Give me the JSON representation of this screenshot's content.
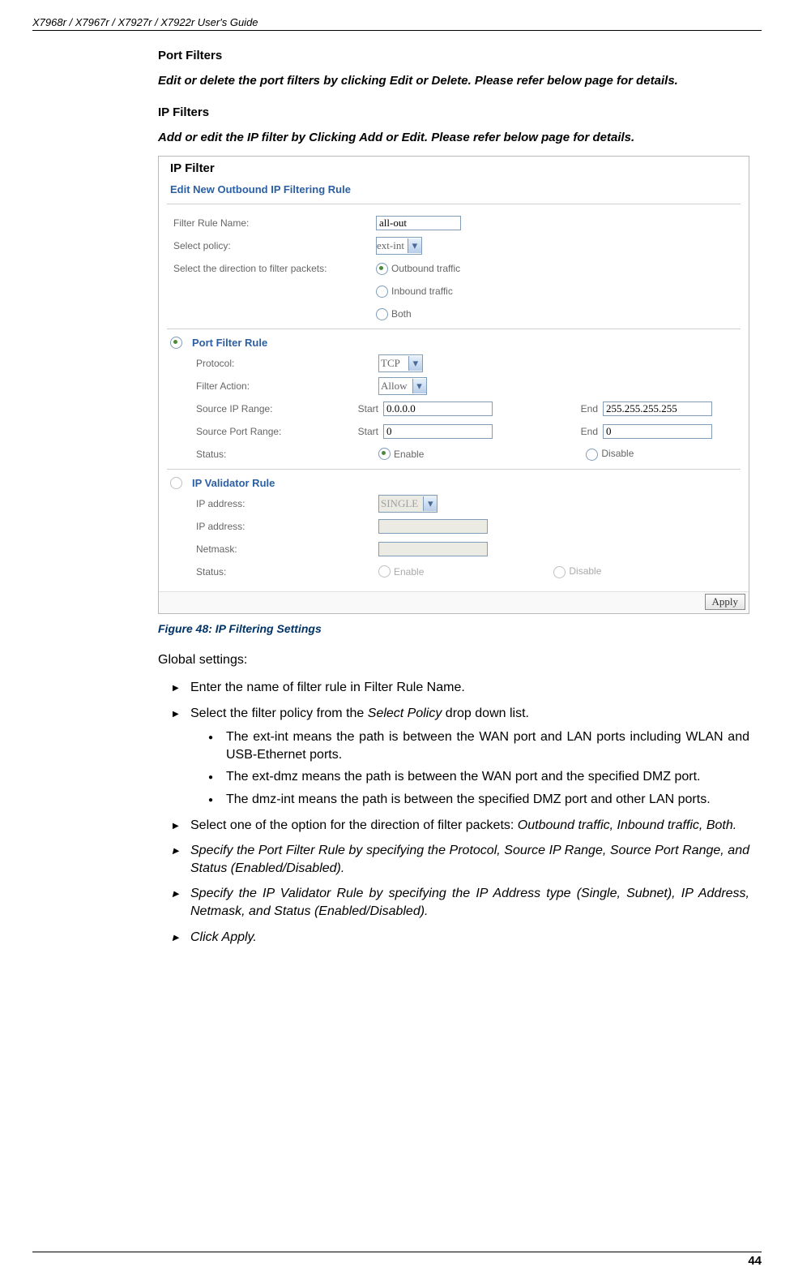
{
  "header": {
    "title": "X7968r / X7967r / X7927r / X7922r User's Guide"
  },
  "sections": {
    "port_filters_heading": "Port Filters",
    "port_filters_note": "Edit or delete the port filters by clicking Edit or Delete. Please refer below page for details.",
    "ip_filters_heading": "IP Filters",
    "ip_filters_note": "Add or edit the IP filter by Clicking Add or Edit. Please refer below page for details."
  },
  "ui": {
    "title": "IP Filter",
    "subtitle": "Edit New Outbound IP Filtering Rule",
    "rows": {
      "filter_rule_name_label": "Filter Rule Name:",
      "filter_rule_name_value": "all-out",
      "select_policy_label": "Select policy:",
      "select_policy_value": "ext-int",
      "direction_label": "Select the direction to filter packets:",
      "direction_opt1": "Outbound traffic",
      "direction_opt2": "Inbound traffic",
      "direction_opt3": "Both"
    },
    "port_rule": {
      "heading": "Port Filter Rule",
      "protocol_label": "Protocol:",
      "protocol_value": "TCP",
      "action_label": "Filter Action:",
      "action_value": "Allow",
      "src_ip_label": "Source IP Range:",
      "start_label": "Start",
      "end_label": "End",
      "src_ip_start": "0.0.0.0",
      "src_ip_end": "255.255.255.255",
      "src_port_label": "Source Port Range:",
      "src_port_start": "0",
      "src_port_end": "0",
      "status_label": "Status:",
      "status_enable": "Enable",
      "status_disable": "Disable"
    },
    "validator_rule": {
      "heading": "IP Validator Rule",
      "ip_type_label": "IP address:",
      "ip_type_value": "SINGLE",
      "ip_addr_label": "IP address:",
      "netmask_label": "Netmask:",
      "status_label": "Status:",
      "status_enable": "Enable",
      "status_disable": "Disable"
    },
    "apply_button": "Apply"
  },
  "figure_caption": "Figure 48: IP Filtering Settings",
  "global_heading": "Global settings:",
  "bullets": {
    "b1": "Enter the name of filter rule in Filter Rule Name.",
    "b2_pre": "Select the filter policy from the ",
    "b2_em": "Select Policy",
    "b2_post": " drop down list.",
    "b2_sub1": "The ext-int means the path is between the WAN port and LAN ports including WLAN and USB-Ethernet ports.",
    "b2_sub2": "The ext-dmz means the path is between the WAN port and the specified DMZ port.",
    "b2_sub3": "The dmz-int means the path is between the specified DMZ port and other LAN ports.",
    "b3_pre": "Select one of the option for the direction of filter packets: ",
    "b3_em": "Outbound traffic, Inbound traffic, Both.",
    "b4": "Specify the Port Filter Rule by specifying the Protocol, Source IP Range, Source Port Range, and Status (Enabled/Disabled).",
    "b5": "Specify the IP Validator Rule by specifying the IP Address type (Single, Subnet), IP Address, Netmask, and Status (Enabled/Disabled).",
    "b6": "Click Apply."
  },
  "page_number": "44"
}
